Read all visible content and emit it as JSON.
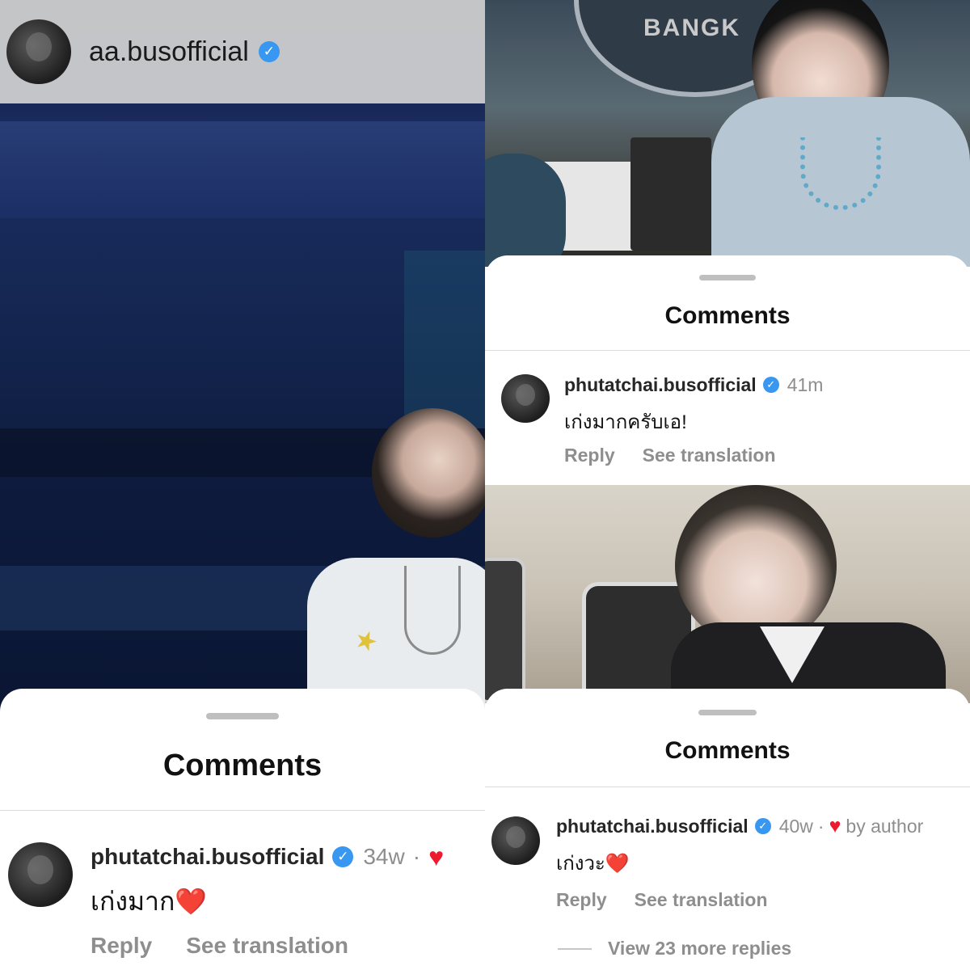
{
  "left": {
    "header": {
      "username": "aa.busofficial"
    },
    "sheet": {
      "title": "Comments",
      "comment": {
        "username": "phutatchai.busofficial",
        "time": "34w",
        "separator": "·",
        "text": "เก่งมาก",
        "emoji": "❤️",
        "reply_label": "Reply",
        "translate_label": "See translation"
      }
    }
  },
  "right_top": {
    "sign_text": "BANGK",
    "sheet": {
      "title": "Comments",
      "comment": {
        "username": "phutatchai.busofficial",
        "time": "41m",
        "text": "เก่งมากครับเอ!",
        "reply_label": "Reply",
        "translate_label": "See translation"
      }
    }
  },
  "right_bottom": {
    "sheet": {
      "title": "Comments",
      "comment": {
        "username": "phutatchai.busofficial",
        "time": "40w",
        "separator": "·",
        "liked_by": "by author",
        "text": "เก่งวะ",
        "emoji": "❤️",
        "reply_label": "Reply",
        "translate_label": "See translation",
        "more_replies": "View 23 more replies"
      }
    }
  },
  "icons": {
    "verified": "verified-badge-icon",
    "heart": "heart-icon",
    "check": "✓",
    "heart_glyph": "♥"
  },
  "colors": {
    "verified": "#3897f0",
    "heart": "#ed1b2e",
    "muted": "#8e8e8e"
  }
}
